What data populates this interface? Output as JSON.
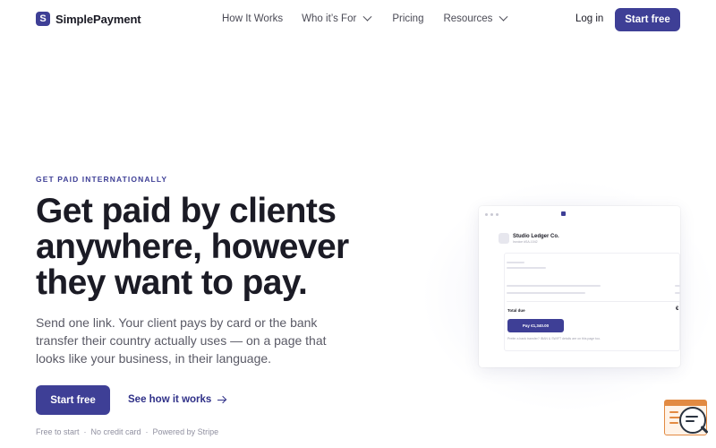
{
  "brand": {
    "name": "SimplePayment",
    "logo_letter": "S",
    "color": "#3e3f96"
  },
  "nav": {
    "links": [
      {
        "label": "How It Works",
        "has_dropdown": false
      },
      {
        "label": "Who it’s For",
        "has_dropdown": true
      },
      {
        "label": "Pricing",
        "has_dropdown": false
      },
      {
        "label": "Resources",
        "has_dropdown": true
      }
    ],
    "login": "Log in",
    "start": "Start free"
  },
  "hero": {
    "eyebrow": "GET PAID INTERNATIONALLY",
    "headline": [
      "Get paid by clients",
      "anywhere, however",
      "they want to pay."
    ],
    "subcopy": [
      "Send one link. Your client pays by card or the bank",
      "transfer their country actually uses — on a page that",
      "looks like your business, in their language."
    ],
    "cta_primary": "Start free",
    "cta_secondary": "See how it works",
    "assurances": [
      "Free to start",
      "·",
      "No credit card",
      "·",
      "Powered by Stripe"
    ]
  },
  "preview": {
    "merchant_name": "Studio Ledger Co.",
    "merchant_sub": "Invoice #SA-1042",
    "total_label": "Total due",
    "currency_symbol": "€",
    "pay_button": "Pay €1,340.00",
    "hint": "Prefer a bank transfer? IBAN & SWIFT details are on this page too."
  },
  "icons": {
    "brand": "brand-logo-icon",
    "dropdown": "chevron-down-icon",
    "arrow": "arrow-right-icon",
    "widget": "page-inspector-icon"
  }
}
